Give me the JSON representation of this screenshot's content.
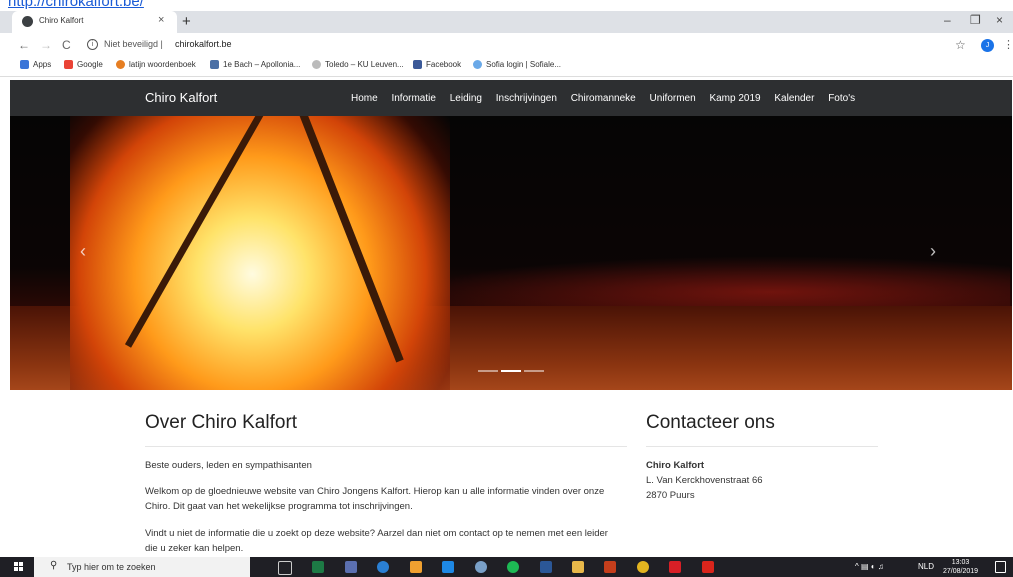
{
  "overlay_link": "http://chirokalfort.be/",
  "browser": {
    "tab_title": "Chiro Kalfort",
    "tab_close": "×",
    "new_tab": "+",
    "nav_back": "←",
    "nav_forward": "→",
    "nav_reload": "C",
    "security_text": "Niet beveiligd",
    "url": "chirokalfort.be",
    "profile_initial": "J",
    "bookmarks": [
      "Apps",
      "Google",
      "latijn woordenboek",
      "1e Bach – Apollonia...",
      "Toledo – KU Leuven...",
      "Facebook",
      "Sofia login | Sofiale..."
    ]
  },
  "site": {
    "brand": "Chiro Kalfort",
    "nav": [
      "Home",
      "Informatie",
      "Leiding",
      "Inschrijvingen",
      "Chiromanneke",
      "Uniformen",
      "Kamp 2019",
      "Kalender",
      "Foto's"
    ],
    "carousel": {
      "prev": "‹",
      "next": "›",
      "indicators": 3,
      "active": 1
    }
  },
  "about": {
    "title": "Over Chiro Kalfort",
    "p1": "Beste ouders, leden en sympathisanten",
    "p2": "Welkom op de gloednieuwe website van Chiro Jongens Kalfort. Hierop kan u alle informatie vinden over onze Chiro. Dit gaat van het wekelijkse programma tot inschrijvingen.",
    "p3": "Vindt u niet de informatie die u zoekt op deze website? Aarzel dan niet om contact op te nemen met een leider die u zeker kan helpen."
  },
  "contact": {
    "title": "Contacteer ons",
    "name": "Chiro Kalfort",
    "street": "L. Van Kerckhovenstraat 66",
    "city": "2870 Puurs"
  },
  "taskbar": {
    "search_placeholder": "Typ hier om te zoeken",
    "lang": "NLD",
    "time": "13:03",
    "date": "27/08/2019"
  }
}
